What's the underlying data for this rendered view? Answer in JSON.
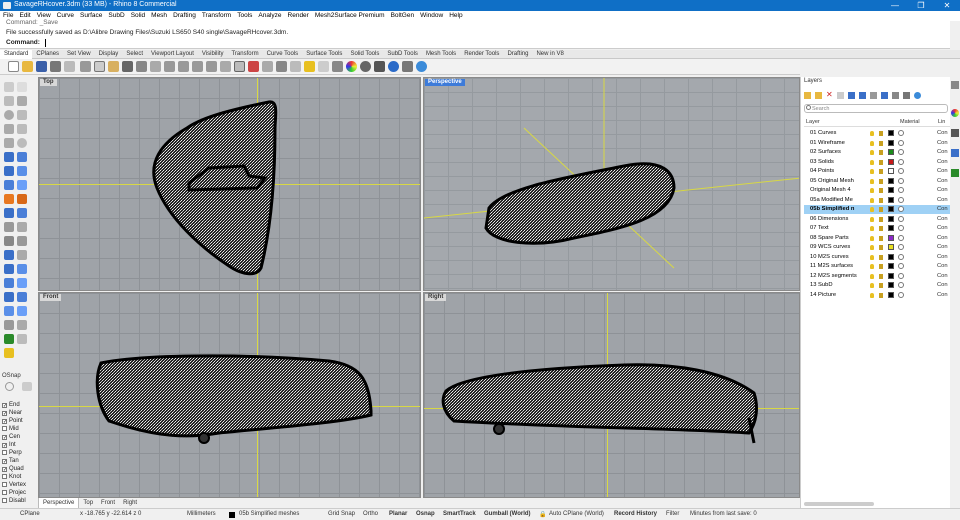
{
  "window": {
    "title": "SavageRHcover.3dm (33 MB) - Rhino 8 Commercial",
    "minimize": "—",
    "maximize": "❐",
    "close": "✕"
  },
  "menu": [
    "File",
    "Edit",
    "View",
    "Curve",
    "Surface",
    "SubD",
    "Solid",
    "Mesh",
    "Drafting",
    "Transform",
    "Tools",
    "Analyze",
    "Render",
    "Mesh2Surface Premium",
    "BoltGen",
    "Window",
    "Help"
  ],
  "command": {
    "history1": "Command: _Save",
    "history2": "File successfully saved as D:\\Alibre Drawing Files\\Suzuki LS650 S40 single\\SavageRHcover.3dm.",
    "prompt": "Command:"
  },
  "tabs": [
    "Standard",
    "CPlanes",
    "Set View",
    "Display",
    "Select",
    "Viewport Layout",
    "Visibility",
    "Transform",
    "Curve Tools",
    "Surface Tools",
    "Solid Tools",
    "SubD Tools",
    "Mesh Tools",
    "Render Tools",
    "Drafting",
    "New in V8"
  ],
  "viewports": {
    "top": "Top",
    "perspective": "Perspective",
    "front": "Front",
    "right": "Right"
  },
  "viewport_tabs": [
    "Perspective",
    "Top",
    "Front",
    "Right"
  ],
  "osnap": {
    "title": "OSnap",
    "items": [
      {
        "label": "End",
        "checked": true
      },
      {
        "label": "Near",
        "checked": true
      },
      {
        "label": "Point",
        "checked": true
      },
      {
        "label": "Mid",
        "checked": false
      },
      {
        "label": "Cen",
        "checked": true
      },
      {
        "label": "Int",
        "checked": true
      },
      {
        "label": "Perp",
        "checked": false
      },
      {
        "label": "Tan",
        "checked": true
      },
      {
        "label": "Quad",
        "checked": true
      },
      {
        "label": "Knot",
        "checked": false
      },
      {
        "label": "Vertex",
        "checked": false
      },
      {
        "label": "Projec",
        "checked": false
      },
      {
        "label": "Disabl",
        "checked": false
      }
    ]
  },
  "layers_panel": {
    "title": "Layers",
    "search_placeholder": "Search",
    "col_layer": "Layer",
    "col_material": "Material",
    "col_linetype": "Lin",
    "rows": [
      {
        "name": "01 Curves",
        "color": "#000000",
        "linetype": "Con"
      },
      {
        "name": "01 Wireframe",
        "color": "#000000",
        "linetype": "Con"
      },
      {
        "name": "02 Surfaces",
        "color": "#1a8c1a",
        "linetype": "Con"
      },
      {
        "name": "03 Solids",
        "color": "#c81818",
        "linetype": "Con"
      },
      {
        "name": "04 Points",
        "color": "#ffffff",
        "linetype": "Con"
      },
      {
        "name": "05 Original Mesh",
        "color": "#000000",
        "linetype": "Con"
      },
      {
        "name": "Original Mesh 4",
        "color": "#000000",
        "linetype": "Con"
      },
      {
        "name": "05a Modified Me",
        "color": "#000000",
        "linetype": "Con"
      },
      {
        "name": "05b Simplified n",
        "color": "#000000",
        "linetype": "Con",
        "selected": true
      },
      {
        "name": "06 Dimensions",
        "color": "#000000",
        "linetype": "Con"
      },
      {
        "name": "07 Text",
        "color": "#000000",
        "linetype": "Con"
      },
      {
        "name": "08 Spare Parts",
        "color": "#8c28c8",
        "linetype": "Con"
      },
      {
        "name": "09 WCS curves",
        "color": "#e8e020",
        "linetype": "Con"
      },
      {
        "name": "10 M2S curves",
        "color": "#000000",
        "linetype": "Con"
      },
      {
        "name": "11 M2S surfaces",
        "color": "#000000",
        "linetype": "Con"
      },
      {
        "name": "12 M2S segments",
        "color": "#000000",
        "linetype": "Con"
      },
      {
        "name": "13 SubD",
        "color": "#000000",
        "linetype": "Con"
      },
      {
        "name": "14 Picture",
        "color": "#000000",
        "linetype": "Con"
      }
    ]
  },
  "status": {
    "cplane": "CPlane",
    "coords": "x -18.765  y -22.614  z 0",
    "units": "Millimeters",
    "layer": "05b Simplified meshes",
    "grid_snap": "Grid Snap",
    "ortho": "Ortho",
    "planar": "Planar",
    "osnap": "Osnap",
    "smarttrack": "SmartTrack",
    "gumball": "Gumball (World)",
    "autocplane": "Auto CPlane (World)",
    "record": "Record History",
    "filter": "Filter",
    "save": "Minutes from last save: 0"
  }
}
